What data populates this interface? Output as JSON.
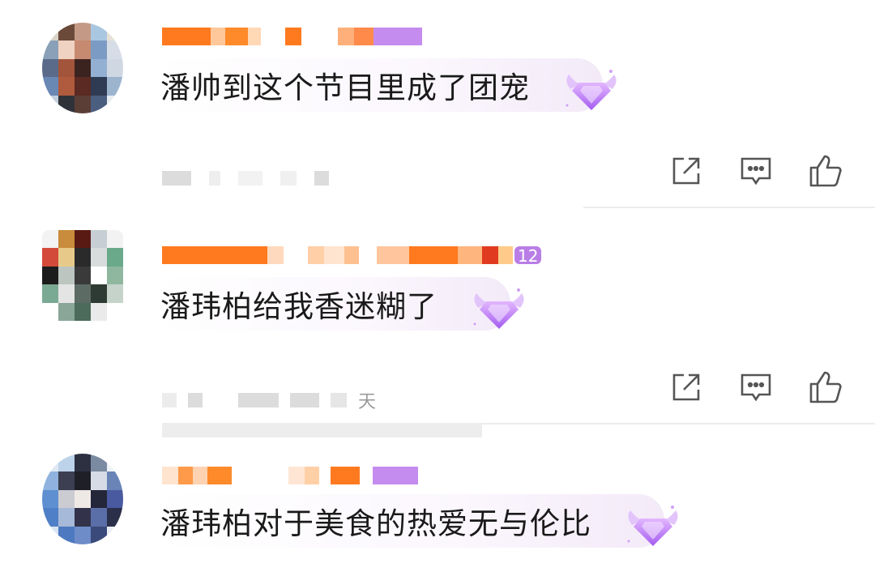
{
  "comments": [
    {
      "text": "潘帅到这个节目里成了团宠",
      "level": "",
      "meta_suffix": ""
    },
    {
      "text": "潘玮柏给我香迷糊了",
      "level": "12",
      "meta_suffix": "天"
    },
    {
      "text": "潘玮柏对于美食的热爱无与伦比",
      "level": "",
      "meta_suffix": ""
    }
  ],
  "actions": {
    "share_icon": "share-icon",
    "comment_icon": "comment-icon",
    "like_icon": "like-icon"
  },
  "colors": {
    "username_orange": "#ff7a1f",
    "username_purple": "#c58cf0",
    "badge_purple": "#b46cf0",
    "icon_gray": "#555555",
    "bubble_tint": "#f3eaf8"
  }
}
